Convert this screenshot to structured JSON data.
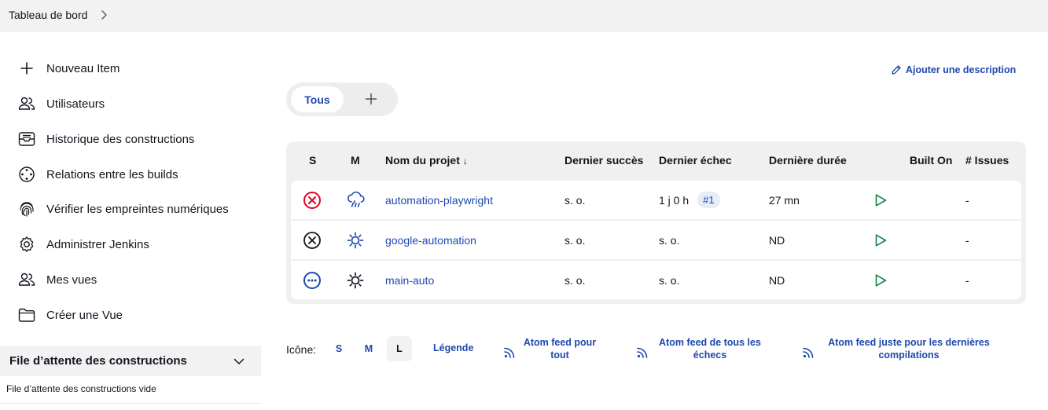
{
  "breadcrumb": {
    "root": "Tableau de bord"
  },
  "sidebar": {
    "items": [
      {
        "label": "Nouveau Item",
        "icon": "plus-icon"
      },
      {
        "label": "Utilisateurs",
        "icon": "users-icon"
      },
      {
        "label": "Historique des constructions",
        "icon": "inbox-icon"
      },
      {
        "label": "Relations entre les builds",
        "icon": "relations-icon"
      },
      {
        "label": "Vérifier les empreintes numériques",
        "icon": "fingerprint-icon"
      },
      {
        "label": "Administrer Jenkins",
        "icon": "gear-icon"
      },
      {
        "label": "Mes vues",
        "icon": "users-icon"
      },
      {
        "label": "Créer une Vue",
        "icon": "folder-icon"
      }
    ]
  },
  "queue": {
    "title": "File d’attente des constructions",
    "empty_text": "File d’attente des constructions vide"
  },
  "header": {
    "add_description": "Ajouter une description"
  },
  "tabs": {
    "active": "Tous"
  },
  "table": {
    "columns": {
      "s": "S",
      "m": "M",
      "name": "Nom du projet",
      "sort_indicator": "↓",
      "last_success": "Dernier succès",
      "last_failure": "Dernier échec",
      "last_duration": "Dernière durée",
      "built_on": "Built On",
      "issues": "# Issues"
    },
    "rows": [
      {
        "status": "failed",
        "weather": "storm",
        "name": "automation-playwright",
        "last_success": "s. o.",
        "last_failure": "1 j 0 h",
        "failure_build": "#1",
        "last_duration": "27 mn",
        "issues": "-"
      },
      {
        "status": "aborted",
        "weather": "sunny",
        "name": "google-automation",
        "last_success": "s. o.",
        "last_failure": "s. o.",
        "failure_build": "",
        "last_duration": "ND",
        "issues": "-"
      },
      {
        "status": "notbuilt",
        "weather": "sunny",
        "name": "main-auto",
        "last_success": "s. o.",
        "last_failure": "s. o.",
        "failure_build": "",
        "last_duration": "ND",
        "issues": "-"
      }
    ]
  },
  "footer": {
    "icon_label": "Icône:",
    "sizes": [
      "S",
      "M",
      "L"
    ],
    "active_size": "L",
    "legend": "Légende",
    "feeds": [
      {
        "line1": "Atom feed pour",
        "line2": "tout"
      },
      {
        "line1": "Atom feed de tous les",
        "line2": "échecs"
      },
      {
        "line1": "Atom feed juste pour les dernières",
        "line2": "compilations"
      }
    ]
  },
  "colors": {
    "link": "#1f48ad",
    "failed": "#e6001f",
    "run": "#138347",
    "notbuilt": "#1f48ad"
  }
}
